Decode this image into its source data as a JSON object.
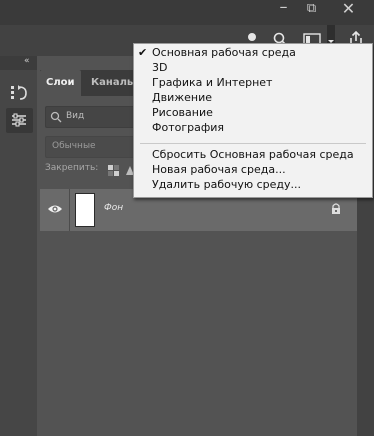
{
  "menu": {
    "items": [
      {
        "label": "Основная рабочая среда",
        "checked": true
      },
      {
        "label": "3D"
      },
      {
        "label": "Графика и Интернет"
      },
      {
        "label": "Движение"
      },
      {
        "label": "Рисование"
      },
      {
        "label": "Фотография"
      }
    ],
    "actions": [
      {
        "label": "Сбросить Основная рабочая среда"
      },
      {
        "label": "Новая рабочая среда..."
      },
      {
        "label": "Удалить рабочую среду..."
      }
    ],
    "check_glyph": "✔"
  },
  "panel": {
    "tabs": [
      "Слои",
      "Каналы"
    ],
    "search_placeholder": "Вид",
    "blend_mode": "Обычные",
    "lock_label": "Закрепить:"
  },
  "layers": [
    {
      "name": "Фон",
      "visible": true,
      "locked": true
    }
  ],
  "window_controls": {
    "minimize": "–",
    "restore": "⧉",
    "close": "✕"
  },
  "colors": {
    "menu_bg": "#f2f2f2",
    "panel_bg": "#535353",
    "selected_layer": "#6a6a6a"
  }
}
